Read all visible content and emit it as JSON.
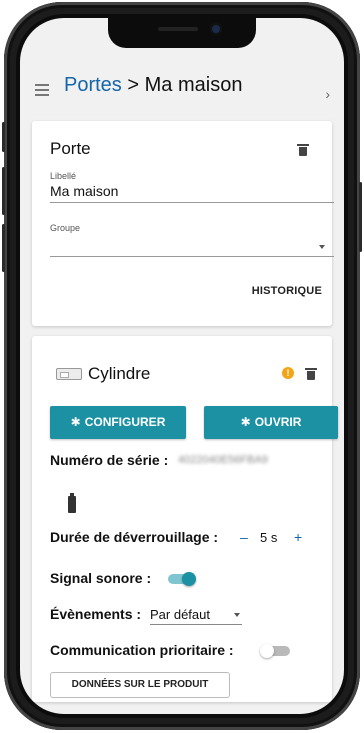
{
  "header": {
    "breadcrumb_parent": "Portes",
    "separator": ">",
    "current_page": "Ma maison"
  },
  "door_card": {
    "title": "Porte",
    "label_field": {
      "label": "Libellé",
      "value": "Ma maison"
    },
    "group_field": {
      "label": "Groupe",
      "value": ""
    },
    "history_button": "HISTORIQUE"
  },
  "cylinder_card": {
    "title": "Cylindre",
    "warning_icon_text": "!",
    "configure_button": "CONFIGURER",
    "open_button": "OUVRIR",
    "serial_label": "Numéro de série :",
    "serial_value": "4022040E56FBA9",
    "unlock_label": "Durée de déverrouillage :",
    "unlock_minus": "–",
    "unlock_value": "5 s",
    "unlock_plus": "+",
    "beep_label": "Signal sonore :",
    "beep_on": true,
    "events_label": "Évènements :",
    "events_value": "Par défaut",
    "priority_label": "Communication prioritaire :",
    "priority_on": false,
    "product_data_button": "DONNÉES SUR LE PRODUIT"
  },
  "colors": {
    "accent": "#1b91a3",
    "link": "#1565a8",
    "warning": "#f2a516",
    "toggle_on_knob": "#1b91a3",
    "toggle_off_knob": "#ffffff"
  },
  "icons": {
    "menu": "hamburger-menu-icon",
    "chevron": "chevron-right-icon",
    "trash": "trash-icon",
    "bluetooth": "bluetooth-icon",
    "battery": "battery-icon",
    "cylinder": "cylinder-lock-icon",
    "warning": "warning-icon"
  }
}
